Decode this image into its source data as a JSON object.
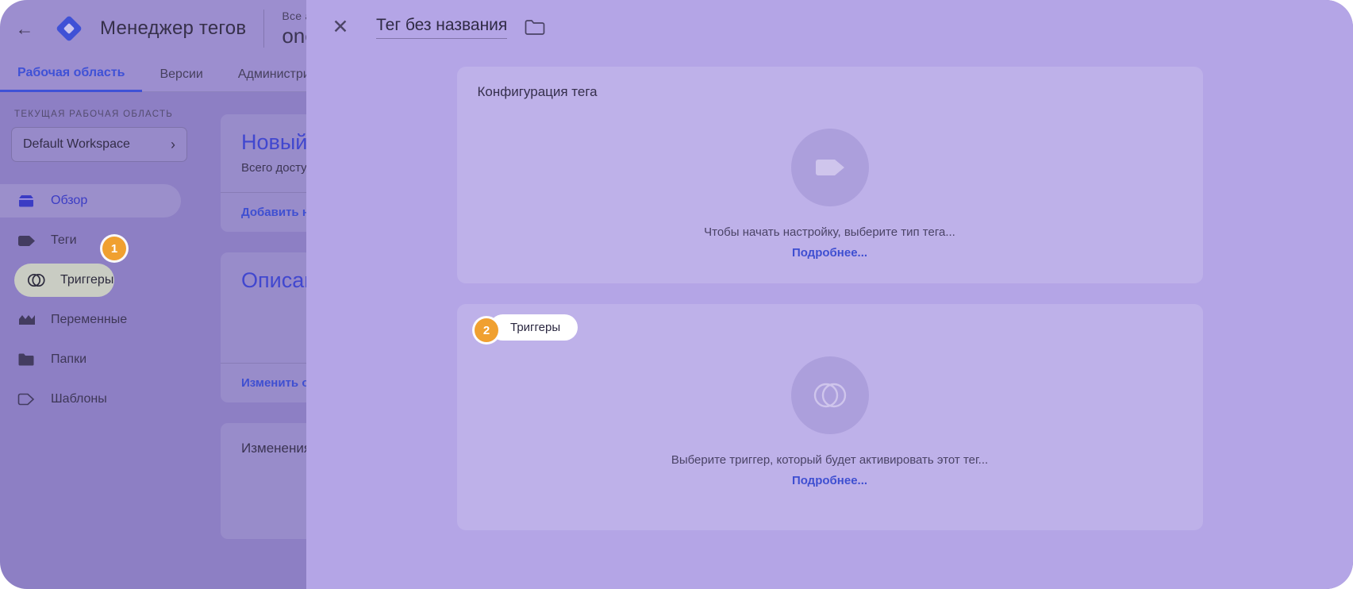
{
  "header": {
    "back_icon": "arrow-left-icon",
    "logo_icon": "gtm-diamond-logo",
    "app_title": "Менеджер тегов",
    "account_label": "Все аккаунты",
    "account_name": "onespo"
  },
  "nav": {
    "tabs": [
      {
        "label": "Рабочая область",
        "active": true
      },
      {
        "label": "Версии",
        "active": false
      },
      {
        "label": "Администрирован",
        "active": false
      }
    ]
  },
  "sidebar": {
    "caption": "ТЕКУЩАЯ РАБОЧАЯ ОБЛАСТЬ",
    "workspace_name": "Default Workspace",
    "workspace_chevron": "chevron-right-icon",
    "items": [
      {
        "label": "Обзор",
        "icon": "overview-icon",
        "state": "active"
      },
      {
        "label": "Теги",
        "icon": "tag-icon",
        "state": "normal"
      },
      {
        "label": "Триггеры",
        "icon": "trigger-icon",
        "state": "highlighted"
      },
      {
        "label": "Переменные",
        "icon": "variables-icon",
        "state": "normal"
      },
      {
        "label": "Папки",
        "icon": "folder-icon",
        "state": "normal"
      },
      {
        "label": "Шаблоны",
        "icon": "template-icon",
        "state": "normal"
      }
    ]
  },
  "background_cards": [
    {
      "title": "Новый тег",
      "subtitle": "Всего доступно тегов.",
      "action": "Добавить новый"
    },
    {
      "title": "Описание",
      "action": "Изменить описание"
    },
    {
      "title": "Изменения в р"
    }
  ],
  "overlay": {
    "close_icon": "close-icon",
    "tag_title": "Тег без названия",
    "folder_icon": "folder-icon",
    "config_panel": {
      "heading": "Конфигурация тега",
      "placeholder_icon": "tag-shape-icon",
      "placeholder_text": "Чтобы начать настройку, выберите тип тега...",
      "link": "Подробнее..."
    },
    "triggers_panel": {
      "placeholder_icon": "trigger-circle-icon",
      "placeholder_text": "Выберите триггер, который будет активировать этот тег...",
      "link": "Подробнее..."
    }
  },
  "callouts": [
    {
      "number": "1",
      "target": "sidebar-triggers"
    },
    {
      "number": "2",
      "number_label": "2",
      "tooltip": "Триггеры"
    }
  ],
  "colors": {
    "accent_blue": "#3f4fd1",
    "badge_orange": "#f0a030",
    "app_purple": "#9c8ecf",
    "sidebar_purple": "#8d7fc4",
    "overlay_purple": "#b4a5e6"
  }
}
